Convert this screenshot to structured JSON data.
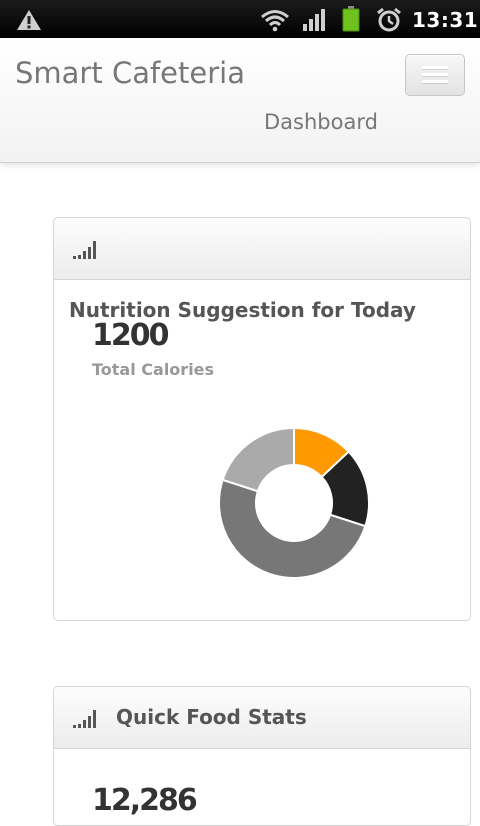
{
  "status_bar": {
    "clock": "13:31",
    "icons": [
      "warning-icon",
      "wifi-icon",
      "signal-icon",
      "battery-icon",
      "alarm-icon"
    ]
  },
  "header": {
    "brand": "Smart Cafeteria",
    "nav_link": "Dashboard",
    "menu_icon": "hamburger-menu-icon"
  },
  "widgets": {
    "nutrition": {
      "header_title": "",
      "title": "Nutrition Suggestion for Today",
      "calories_value": "1200",
      "calories_label": "Total Calories",
      "icon": "bar-chart-icon"
    },
    "quick_food_stats": {
      "header_title": "Quick Food Stats",
      "value": "12,286",
      "icon": "bar-chart-icon"
    }
  },
  "chart_data": {
    "type": "pie",
    "title": "",
    "segments": [
      {
        "value": 13,
        "color": "#ff9900"
      },
      {
        "value": 17,
        "color": "#222222"
      },
      {
        "value": 50,
        "color": "#777777"
      },
      {
        "value": 20,
        "color": "#aaaaaa"
      }
    ]
  }
}
